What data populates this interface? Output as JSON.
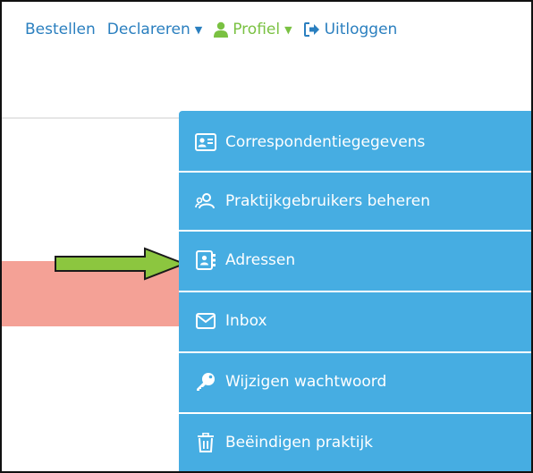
{
  "nav": {
    "order": "Bestellen",
    "declare": "Declareren",
    "profile": "Profiel",
    "logout": "Uitloggen",
    "caret": "▼"
  },
  "menu": {
    "items": [
      {
        "label": "Correspondentiegegevens",
        "icon": "id-card-icon"
      },
      {
        "label": "Praktijkgebruikers beheren",
        "icon": "users-icon"
      },
      {
        "label": "Adressen",
        "icon": "address-book-icon"
      },
      {
        "label": "Inbox",
        "icon": "envelope-icon"
      },
      {
        "label": "Wijzigen wachtwoord",
        "icon": "key-icon"
      },
      {
        "label": "Beëindigen praktijk",
        "icon": "trash-icon"
      }
    ]
  },
  "colors": {
    "nav_link": "#2a7fbf",
    "profile": "#7ac142",
    "menu_bg": "#46ade2",
    "banner": "#f4a196",
    "arrow_fill": "#8cc63f"
  }
}
